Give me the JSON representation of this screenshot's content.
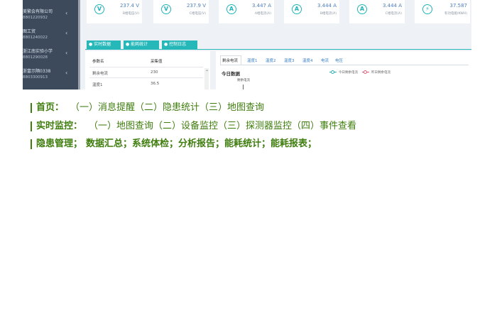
{
  "sidebar": {
    "items": [
      {
        "name": "美繁会有限公司",
        "code": "8801220932"
      },
      {
        "name": "图工贸",
        "code": "8801240022"
      },
      {
        "name": "浙江南实验小学",
        "code": "8801290028"
      },
      {
        "name": "浙富示隔0338",
        "code": "8803300913"
      }
    ]
  },
  "cards": [
    {
      "icon": "V",
      "value": "237.4 V",
      "label": "B相电压(V)"
    },
    {
      "icon": "V",
      "value": "237.9 V",
      "label": "C相电压(V)"
    },
    {
      "icon": "A",
      "value": "3.447 A",
      "label": "A相电流(A)"
    },
    {
      "icon": "A",
      "value": "3.444 A",
      "label": "B相电流(A)"
    },
    {
      "icon": "A",
      "value": "3.444 A",
      "label": "C相电流(A)"
    },
    {
      "icon": "⚡",
      "value": "37.587",
      "label": "有功电能(KWH)"
    }
  ],
  "tabs": [
    "实时数据",
    "能耗统计",
    "控制日志"
  ],
  "table": {
    "headers": [
      "参数名",
      "采集值"
    ],
    "rows": [
      {
        "name": "剩余电流",
        "value": "230"
      },
      {
        "name": "温度1",
        "value": "36.5"
      }
    ]
  },
  "chart_panel": {
    "tabs": [
      "剩余电流",
      "温度1",
      "温度2",
      "温度3",
      "温度4",
      "电流",
      "电压"
    ],
    "title": "今日数据",
    "subtitle": "剩余电流",
    "legend": [
      "今日剩余电流",
      "昨日剩余电流"
    ],
    "colors": {
      "today": "#2db0b3",
      "yesterday": "#e0607a"
    }
  },
  "features": [
    {
      "heading": "首页：",
      "body": "（一）消息提醒（二）隐患统计（三）地图查询"
    },
    {
      "heading": "实时监控：",
      "body": "（一）地图查询（二）设备监控（三）探测器监控（四）事件查看"
    },
    {
      "heading": "隐患管理；",
      "body": "数据汇总；系统体检；分析报告；能耗统计；能耗报表；"
    }
  ],
  "colors": {
    "accent": "#26b7b9",
    "sidebar": "#3c4a5c",
    "feature_text": "#3f7d0e"
  }
}
